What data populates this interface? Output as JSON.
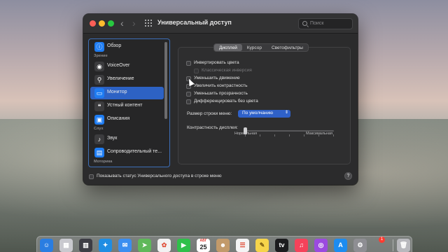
{
  "window": {
    "title": "Универсальный доступ",
    "search_placeholder": "Поиск"
  },
  "sidebar": {
    "items": [
      {
        "label": "Обзор",
        "icon": "info-icon",
        "color": "#1e7cf2"
      },
      {
        "label": "VoiceOver",
        "icon": "voiceover-icon",
        "color": "#3c3c3e"
      },
      {
        "label": "Увеличение",
        "icon": "magnifier-icon",
        "color": "#3c3c3e"
      },
      {
        "label": "Монитор",
        "icon": "display-icon",
        "color": "#1e7cf2"
      },
      {
        "label": "Устный контент",
        "icon": "speech-bubble-icon",
        "color": "#3c3c3e"
      },
      {
        "label": "Описания",
        "icon": "description-icon",
        "color": "#1e7cf2"
      },
      {
        "label": "Звук",
        "icon": "speaker-icon",
        "color": "#3c3c3e"
      },
      {
        "label": "Сопроводительный те...",
        "icon": "captions-icon",
        "color": "#1e7cf2"
      }
    ],
    "sections": {
      "vision": "Зрение",
      "hearing": "Слух",
      "motor": "Моторика"
    }
  },
  "tabs": [
    "Дисплей",
    "Курсор",
    "Светофильтры"
  ],
  "display": {
    "checkboxes": [
      {
        "label": "Инвертировать цвета",
        "enabled": true
      },
      {
        "label": "Классическая инверсия",
        "enabled": false
      },
      {
        "label": "Уменьшить движение",
        "enabled": true
      },
      {
        "label": "Увеличить контрастность",
        "enabled": true
      },
      {
        "label": "Уменьшить прозрачность",
        "enabled": true
      },
      {
        "label": "Дифференцировать без цвета",
        "enabled": true
      }
    ],
    "menu_bar_size_label": "Размер строки меню:",
    "menu_bar_size_value": "По умолчанию",
    "contrast_label": "Контрастность дисплея:",
    "contrast_min_label": "Нормальная",
    "contrast_max_label": "Максимальная",
    "contrast_level": 0
  },
  "footer": {
    "show_status_label": "Показывать статус Универсального доступа в строке меню",
    "help_label": "?"
  },
  "dock": {
    "calendar_month": "АВГ",
    "calendar_day": "25",
    "appstore_badge": "1",
    "apps": [
      {
        "name": "finder-icon",
        "color": "#2a7de1"
      },
      {
        "name": "launchpad-icon",
        "color": "#c9c9cf"
      },
      {
        "name": "mission-control-icon",
        "color": "#3d3d45"
      },
      {
        "name": "safari-icon",
        "color": "#1f8de3"
      },
      {
        "name": "mail-icon",
        "color": "#3b8ef0"
      },
      {
        "name": "maps-icon",
        "color": "#5fb85a"
      },
      {
        "name": "photos-icon",
        "color": "#f2f2f2"
      },
      {
        "name": "facetime-icon",
        "color": "#2fc04a"
      },
      {
        "name": "calendar-icon",
        "color": "#ffffff"
      },
      {
        "name": "contacts-icon",
        "color": "#c29a6a"
      },
      {
        "name": "reminders-icon",
        "color": "#f4f4f4"
      },
      {
        "name": "notes-icon",
        "color": "#f6d44a"
      },
      {
        "name": "appletv-icon",
        "color": "#1c1c1e"
      },
      {
        "name": "music-icon",
        "color": "#f5425a"
      },
      {
        "name": "podcasts-icon",
        "color": "#9b4ae0"
      },
      {
        "name": "appstore-icon",
        "color": "#1d8cf0"
      },
      {
        "name": "system-preferences-icon",
        "color": "#8e8e93"
      },
      {
        "name": "trash-icon",
        "color": "#b8b8bd"
      }
    ]
  }
}
